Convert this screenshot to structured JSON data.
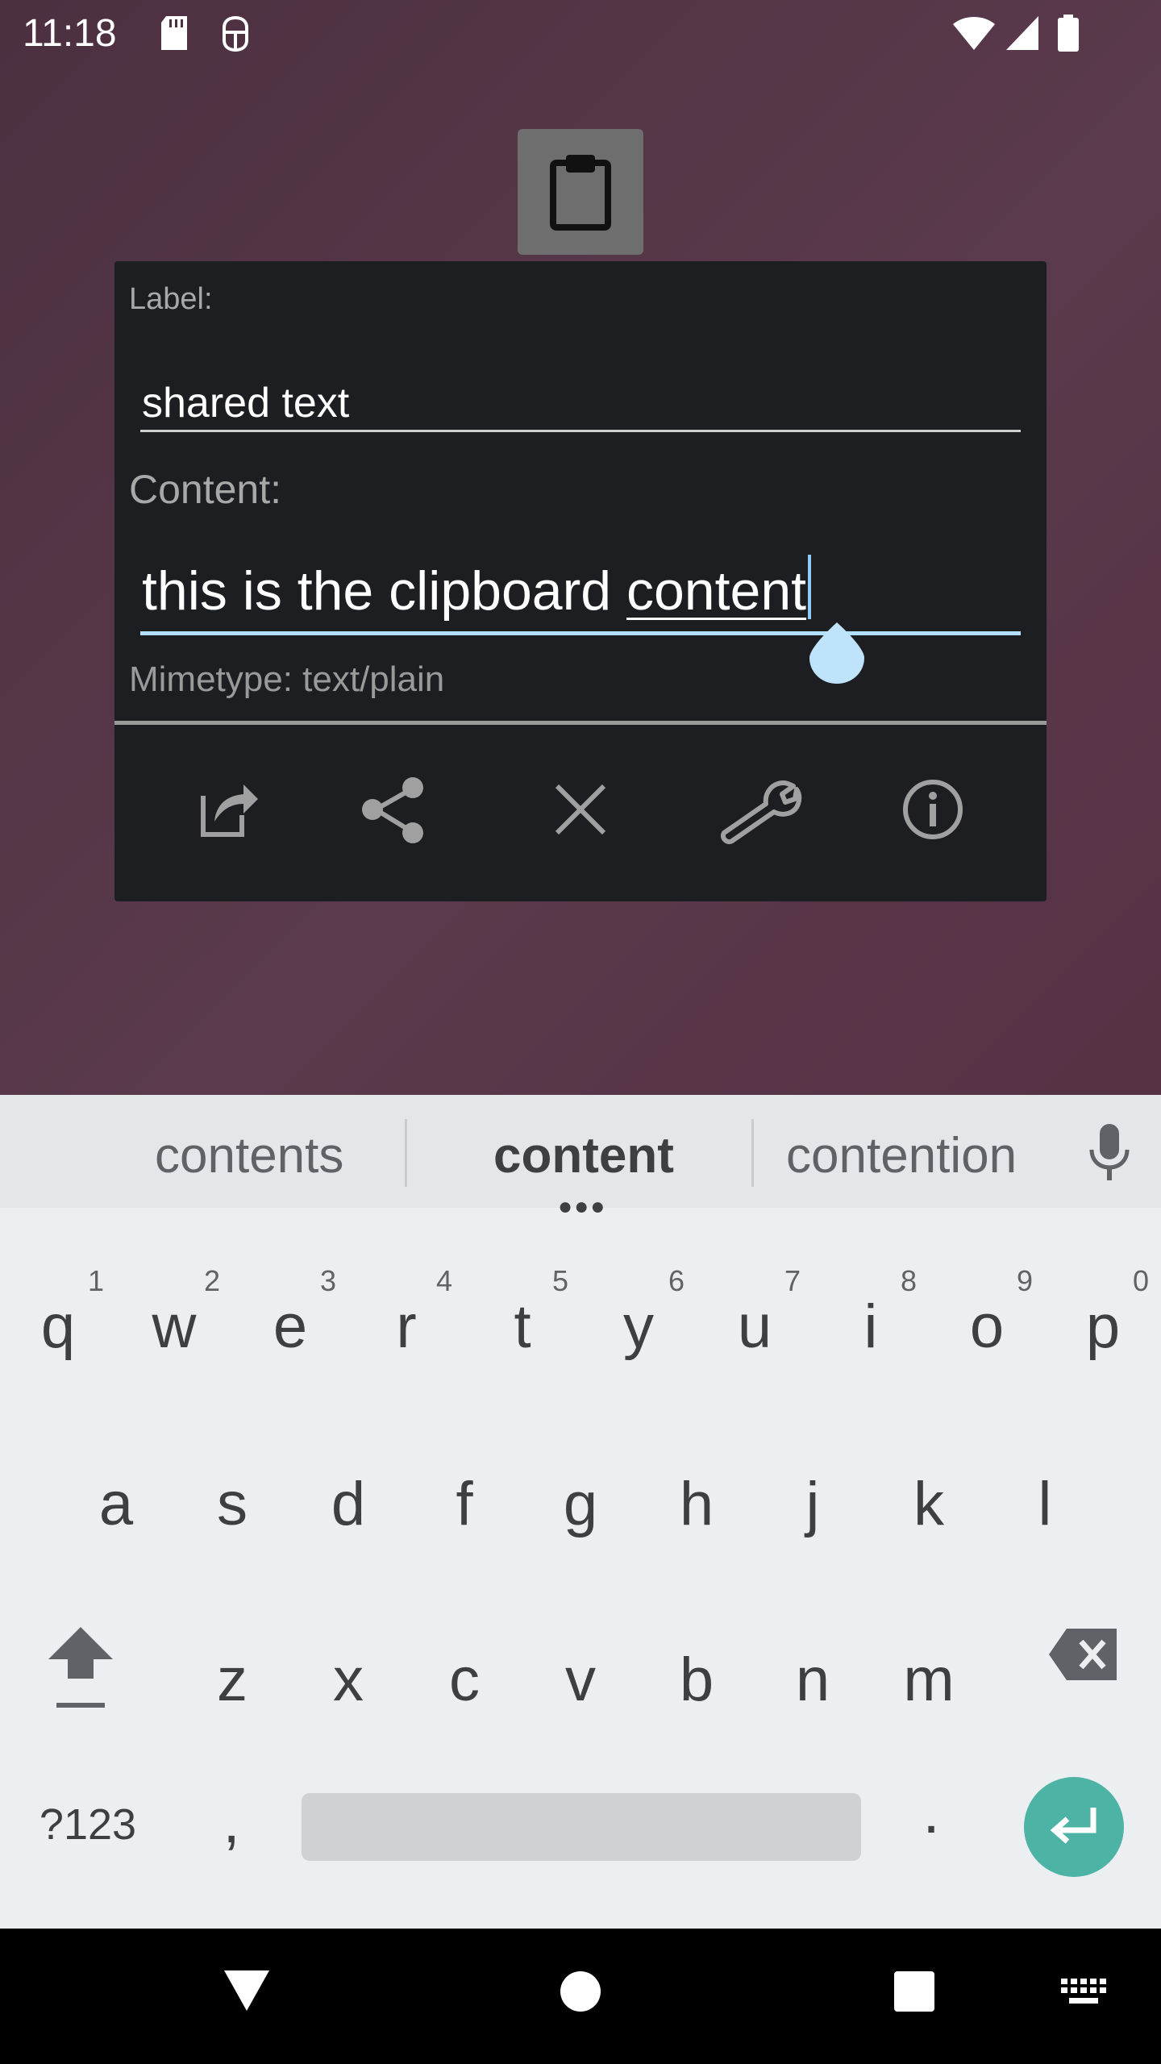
{
  "status_bar": {
    "time": "11:18",
    "icons": [
      "sd-card-icon",
      "debug-icon",
      "wifi-icon",
      "signal-icon",
      "battery-icon"
    ]
  },
  "app": {
    "icon": "clipboard-icon"
  },
  "dialog": {
    "label_title": "Label:",
    "label_value": "shared text",
    "content_title": "Content:",
    "content_before": "this is the clipboard ",
    "content_current_word": "content",
    "mimetype": "Mimetype: text/plain",
    "actions": [
      {
        "name": "edit-share-icon"
      },
      {
        "name": "share-icon"
      },
      {
        "name": "close-icon"
      },
      {
        "name": "wrench-icon"
      },
      {
        "name": "info-icon"
      }
    ]
  },
  "keyboard": {
    "suggestions": [
      "contents",
      "content",
      "contention"
    ],
    "row1": [
      {
        "key": "q",
        "num": "1"
      },
      {
        "key": "w",
        "num": "2"
      },
      {
        "key": "e",
        "num": "3"
      },
      {
        "key": "r",
        "num": "4"
      },
      {
        "key": "t",
        "num": "5"
      },
      {
        "key": "y",
        "num": "6"
      },
      {
        "key": "u",
        "num": "7"
      },
      {
        "key": "i",
        "num": "8"
      },
      {
        "key": "o",
        "num": "9"
      },
      {
        "key": "p",
        "num": "0"
      }
    ],
    "row2": [
      "a",
      "s",
      "d",
      "f",
      "g",
      "h",
      "j",
      "k",
      "l"
    ],
    "row3": [
      "z",
      "x",
      "c",
      "v",
      "b",
      "n",
      "m"
    ],
    "symbols_label": "?123",
    "comma": ",",
    "period": ".",
    "accent_color": "#4cb3a5"
  },
  "nav_bar": {
    "buttons": [
      "back-icon",
      "home-icon",
      "recents-icon",
      "keyboard-switch-icon"
    ]
  }
}
